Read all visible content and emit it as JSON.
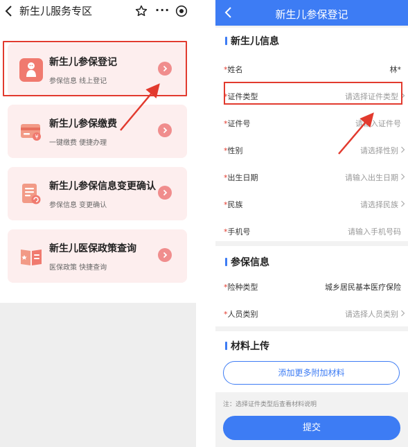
{
  "left": {
    "header": {
      "title": "新生儿服务专区",
      "icons": [
        "back-chevron-icon",
        "star-icon",
        "more-icon",
        "target-icon"
      ],
      "more_glyph": "···"
    },
    "cards": [
      {
        "title": "新生儿参保登记",
        "subtitle": "参保信息 线上登记",
        "icon": "baby-icon"
      },
      {
        "title": "新生儿参保缴费",
        "subtitle": "一键缴费 便捷办理",
        "icon": "card-payment-icon"
      },
      {
        "title": "新生儿参保信息变更确认",
        "subtitle": "参保信息 变更确认",
        "icon": "document-change-icon"
      },
      {
        "title": "新生儿医保政策查询",
        "subtitle": "医保政策 快捷查询",
        "icon": "policy-book-icon"
      }
    ]
  },
  "right": {
    "header": {
      "title": "新生儿参保登记"
    },
    "sections": [
      {
        "title": "新生儿信息",
        "rows": [
          {
            "label": "姓名",
            "value": "林*",
            "chevron": false
          },
          {
            "label": "证件类型",
            "value": "请选择证件类型",
            "chevron": true
          },
          {
            "label": "证件号",
            "value": "请输入证件号",
            "chevron": false
          },
          {
            "label": "性别",
            "value": "请选择性别",
            "chevron": true
          },
          {
            "label": "出生日期",
            "value": "请输入出生日期",
            "chevron": true
          },
          {
            "label": "民族",
            "value": "请选择民族",
            "chevron": true
          },
          {
            "label": "手机号",
            "value": "请输入手机号码",
            "chevron": false
          }
        ]
      },
      {
        "title": "参保信息",
        "rows": [
          {
            "label": "险种类型",
            "value": "城乡居民基本医疗保险",
            "chevron": false
          },
          {
            "label": "人员类别",
            "value": "请选择人员类别",
            "chevron": true
          }
        ]
      },
      {
        "title": "材料上传"
      }
    ],
    "required_mark": "*",
    "add_button": "添加更多附加材料",
    "note": "注：选择证件类型后查看材料说明",
    "submit_button": "提交"
  },
  "colors": {
    "accent": "#3d7cf4",
    "highlight": "#e23a2e",
    "card_bg": "#fdeeee",
    "card_arrow": "#f08d8d"
  }
}
